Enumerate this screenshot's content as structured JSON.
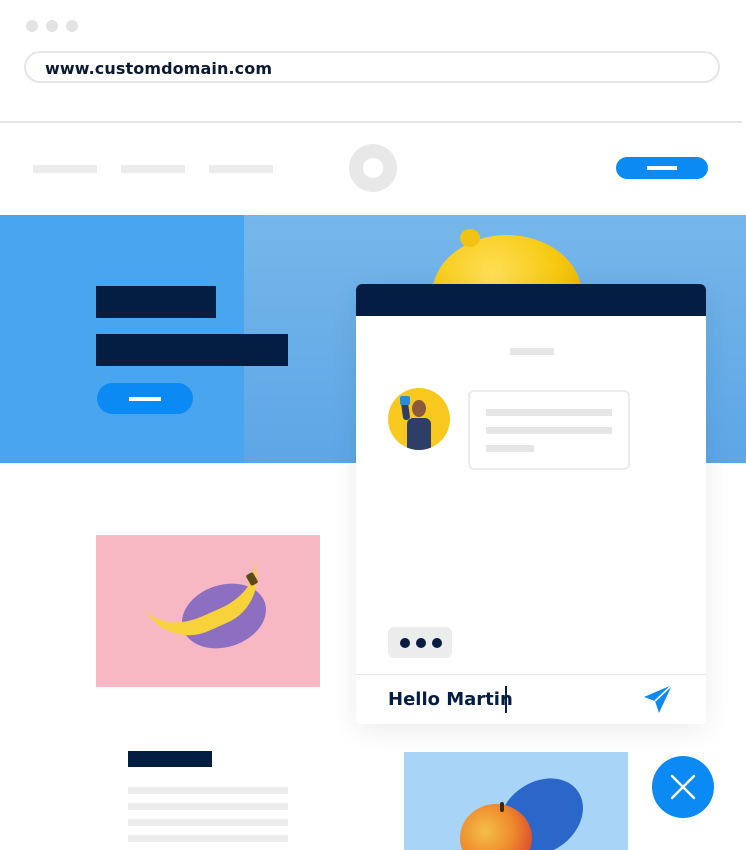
{
  "browser": {
    "url": "www.customdomain.com"
  },
  "chat": {
    "input_text": "Hello Martin"
  },
  "colors": {
    "accent_blue": "#0a8af2",
    "navy": "#041d42",
    "hero_blue": "#4aa5ef",
    "pink_card": "#f7b8c4",
    "light_blue_card": "#a8d5f7",
    "avatar_yellow": "#f8c81e"
  },
  "icons": {
    "send": "send-icon",
    "close": "close-icon",
    "site_logo": "logo-circle-icon"
  }
}
